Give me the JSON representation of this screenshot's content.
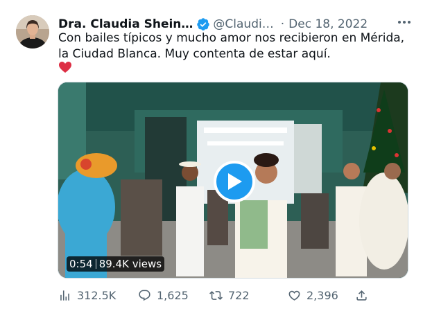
{
  "author": {
    "name": "Dra. Claudia Shein…",
    "handle": "@Claudi…",
    "separator": "·",
    "date": "Dec 18, 2022"
  },
  "tweet": {
    "text": "Con bailes típicos y mucho amor nos recibieron en Mérida, la Ciudad Blanca.  Muy contenta de estar aquí."
  },
  "video": {
    "duration": "0:54",
    "views": "89.4K views"
  },
  "stats": {
    "views": "312.5K",
    "replies": "1,625",
    "retweets": "722",
    "likes": "2,396"
  },
  "colors": {
    "accent": "#1d9bf0",
    "heart": "#e0245e",
    "muted": "#536471"
  }
}
